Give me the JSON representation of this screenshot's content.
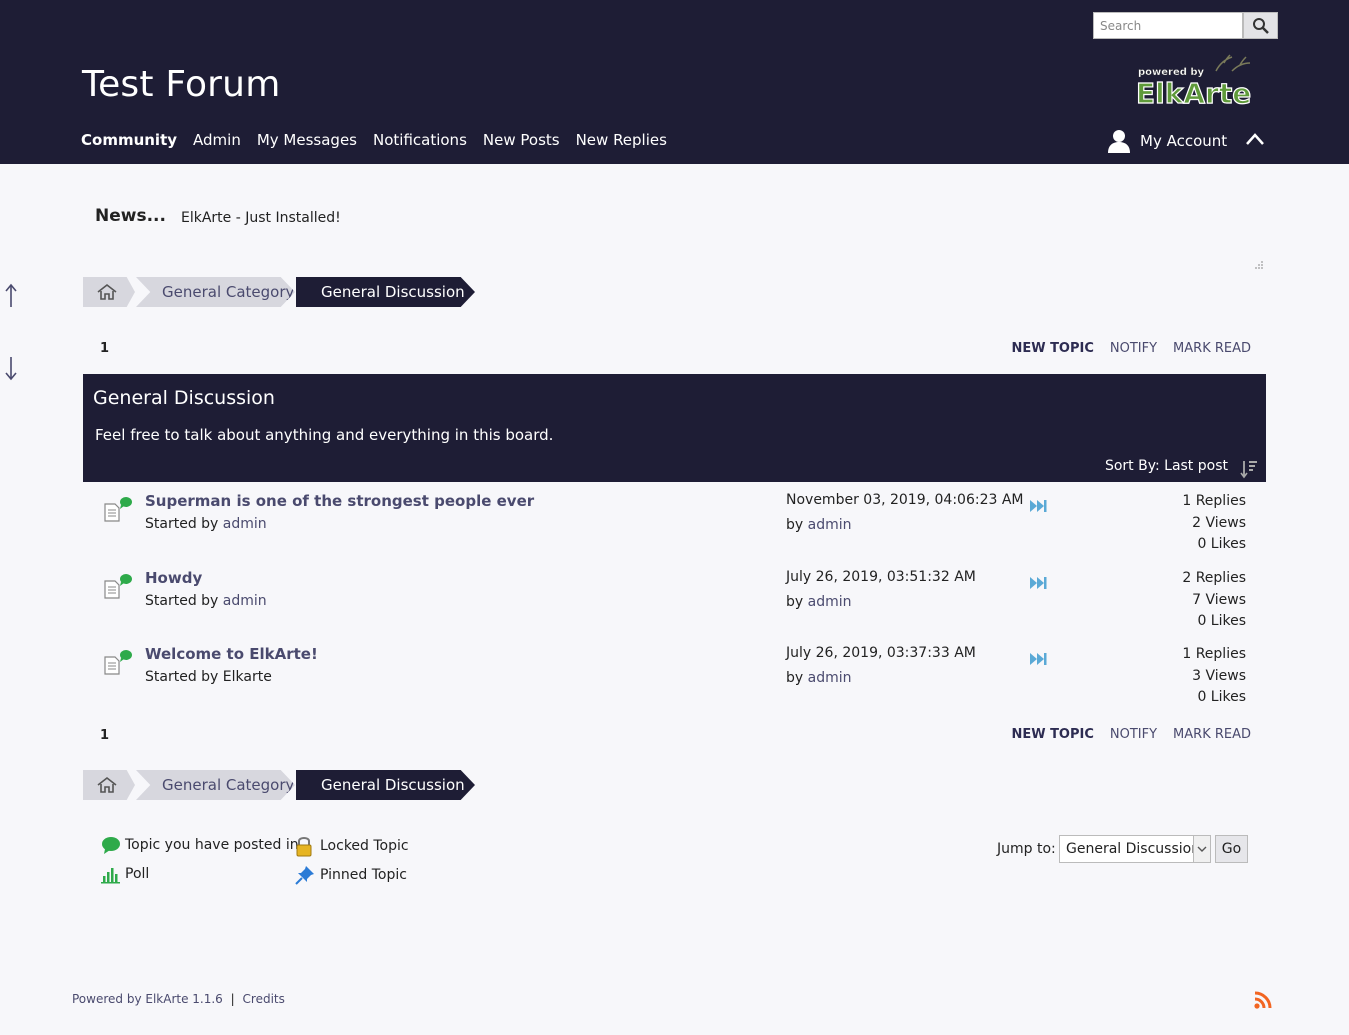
{
  "header": {
    "search_placeholder": "Search",
    "forum_title": "Test Forum",
    "nav": [
      "Community",
      "Admin",
      "My Messages",
      "Notifications",
      "New Posts",
      "New Replies"
    ],
    "account_label": "My Account",
    "logo_text_top": "powered by",
    "logo_text_main": "ElkArte"
  },
  "news": {
    "title": "News...",
    "text": "ElkArte - Just Installed!"
  },
  "breadcrumb": {
    "category": "General Category",
    "board": "General Discussion"
  },
  "pagination": {
    "current_page": "1"
  },
  "actions": {
    "new_topic": "NEW TOPIC",
    "notify": "NOTIFY",
    "mark_read": "MARK READ"
  },
  "board": {
    "name": "General Discussion",
    "description": "Feel free to talk about anything and everything in this board.",
    "sort_label": "Sort By: Last post"
  },
  "topics": [
    {
      "subject": "Superman is one of the strongest people ever",
      "started_by_label": "Started by",
      "starter": "admin",
      "last_post_date": "November 03, 2019, 04:06:23 AM",
      "by_label": "by",
      "last_poster": "admin",
      "replies": "1 Replies",
      "views": "2 Views",
      "likes": "0 Likes"
    },
    {
      "subject": "Howdy",
      "started_by_label": "Started by",
      "starter": "admin",
      "last_post_date": "July 26, 2019, 03:51:32 AM",
      "by_label": "by",
      "last_poster": "admin",
      "replies": "2 Replies",
      "views": "7 Views",
      "likes": "0 Likes"
    },
    {
      "subject": "Welcome to ElkArte!",
      "started_by_label": "Started by",
      "starter": "Elkarte",
      "last_post_date": "July 26, 2019, 03:37:33 AM",
      "by_label": "by",
      "last_poster": "admin",
      "replies": "1 Replies",
      "views": "3 Views",
      "likes": "0 Likes"
    }
  ],
  "legend": {
    "posted_in": "Topic you have posted in",
    "locked": "Locked Topic",
    "poll": "Poll",
    "pinned": "Pinned Topic"
  },
  "jump": {
    "label": "Jump to:",
    "selected": "General Discussion",
    "go": "Go"
  },
  "footer": {
    "powered_by": "Powered by ElkArte 1.1.6",
    "separator": "|",
    "credits": "Credits"
  },
  "colors": {
    "header_bg": "#1e1d35",
    "page_bg": "#f7f7fa",
    "link": "#4a4a6e",
    "green_badge": "#2eaa4a",
    "goto_blue": "#5aa9d6",
    "rss_orange": "#f26522"
  }
}
